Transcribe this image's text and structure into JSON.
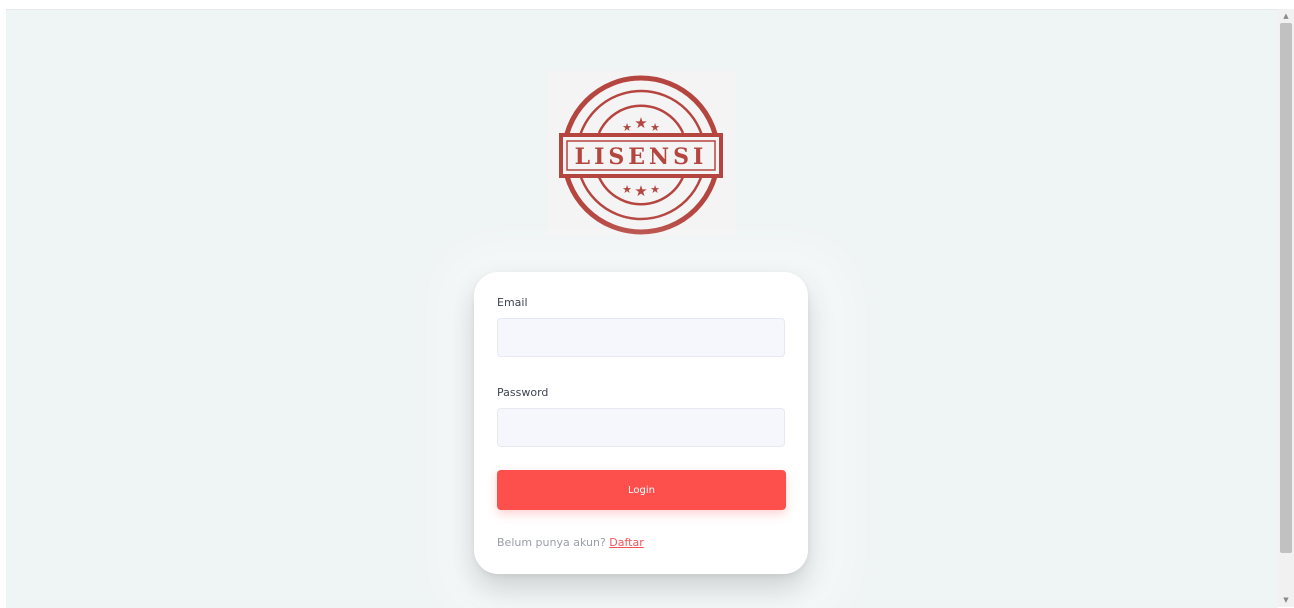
{
  "logo": {
    "text": "LISENSI",
    "color": "#b5453f"
  },
  "form": {
    "email_label": "Email",
    "email_value": "",
    "password_label": "Password",
    "password_value": "",
    "login_label": "Login",
    "signup_prompt": "Belum punya akun?",
    "signup_link": "Daftar"
  },
  "colors": {
    "background": "#eff4f4",
    "accent": "#fd504d",
    "link": "#f2555a"
  },
  "scrollbar": {
    "up_icon": "arrow-up-icon",
    "down_icon": "arrow-down-icon"
  }
}
